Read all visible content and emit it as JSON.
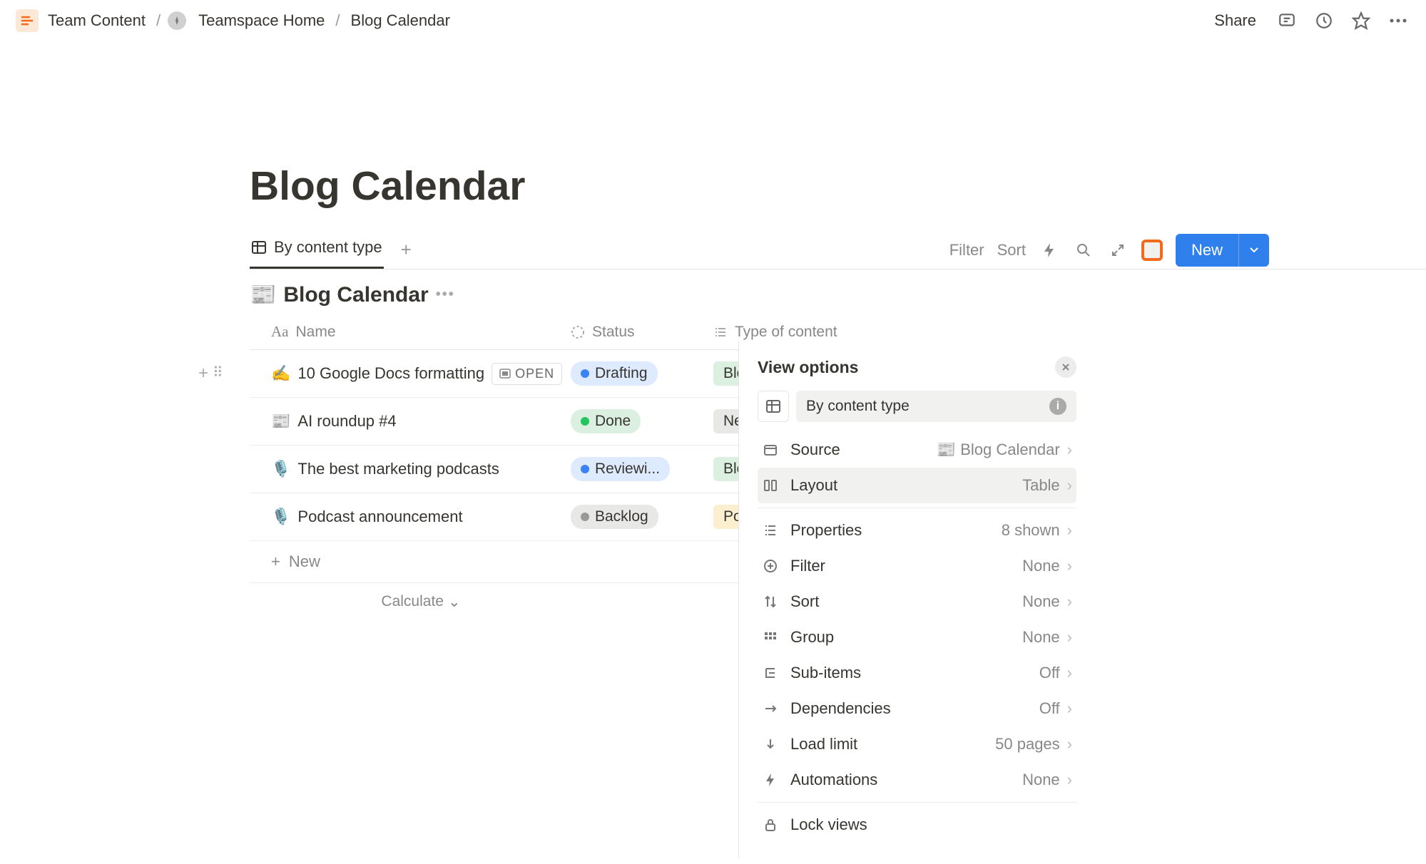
{
  "breadcrumb": {
    "root": "Team Content",
    "workspace": "Teamspace Home",
    "page": "Blog Calendar"
  },
  "topbar": {
    "share": "Share"
  },
  "page": {
    "title": "Blog Calendar"
  },
  "views": {
    "active_tab": "By content type",
    "filter": "Filter",
    "sort": "Sort",
    "new_btn": "New"
  },
  "database": {
    "title": "Blog Calendar",
    "icon": "📰",
    "columns": {
      "name": "Name",
      "status": "Status",
      "type": "Type of content"
    },
    "rows": [
      {
        "emoji": "✍️",
        "name": "10 Google Docs formatting",
        "open": "OPEN",
        "status": "Drafting",
        "status_cls": "drafting",
        "type": "Blog",
        "type_cls": "blog-tag"
      },
      {
        "emoji": "📰",
        "name": "AI roundup #4",
        "status": "Done",
        "status_cls": "done",
        "type": "Newsletter",
        "type_cls": "newsletter-tag"
      },
      {
        "emoji": "🎙️",
        "name": "The best marketing podcasts",
        "status": "Reviewi...",
        "status_cls": "reviewing",
        "type": "Blog",
        "type_cls": "blog-tag"
      },
      {
        "emoji": "🎙️",
        "name": "Podcast announcement",
        "status": "Backlog",
        "status_cls": "backlog",
        "type": "Podcast",
        "type_cls": "podcast-tag"
      }
    ],
    "add_row": "New",
    "calculate": "Calculate"
  },
  "panel": {
    "title": "View options",
    "view_name": "By content type",
    "items": [
      {
        "icon": "source",
        "label": "Source",
        "value": "📰 Blog Calendar"
      },
      {
        "icon": "layout",
        "label": "Layout",
        "value": "Table",
        "hov": true
      },
      {
        "sep": true
      },
      {
        "icon": "props",
        "label": "Properties",
        "value": "8 shown"
      },
      {
        "icon": "filter",
        "label": "Filter",
        "value": "None"
      },
      {
        "icon": "sort",
        "label": "Sort",
        "value": "None"
      },
      {
        "icon": "group",
        "label": "Group",
        "value": "None"
      },
      {
        "icon": "sub",
        "label": "Sub-items",
        "value": "Off"
      },
      {
        "icon": "dep",
        "label": "Dependencies",
        "value": "Off"
      },
      {
        "icon": "load",
        "label": "Load limit",
        "value": "50 pages"
      },
      {
        "icon": "auto",
        "label": "Automations",
        "value": "None"
      },
      {
        "sep": true
      },
      {
        "icon": "lock",
        "label": "Lock views",
        "nochev": true
      }
    ]
  }
}
